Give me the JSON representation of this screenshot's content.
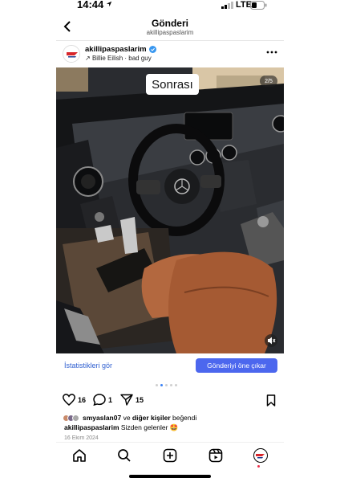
{
  "status_bar": {
    "time": "14:44",
    "network": "LTE"
  },
  "header": {
    "title": "Gönderi",
    "subtitle": "akillipaspaslarim"
  },
  "post": {
    "username": "akillipaspaslarim",
    "music": "Billie Eilish · bad guy",
    "overlay_text": "Sonrası",
    "counter": "2/5",
    "insights_link": "İstatistikleri gör",
    "promote_button": "Gönderiyi öne çıkar",
    "carousel": {
      "count": 5,
      "active": 2
    },
    "likes_count": "16",
    "comments_count": "1",
    "shares_count": "15",
    "liked_by_user": "smyaslan07",
    "liked_by_rest": "diğer kişiler",
    "liked_by_connector": " ve ",
    "liked_by_suffix": " beğendi",
    "caption_user": "akillipaspaslarim",
    "caption_text": " Sizden gelenler 🤩",
    "date": "16 Ekim 2024"
  },
  "colors": {
    "accent": "#4c67ee",
    "link": "#2f5fd0",
    "seat": "#b3683f",
    "verified": "#3897f0"
  },
  "icons": [
    "back-icon",
    "more-icon",
    "verified-icon",
    "heart-icon",
    "comment-icon",
    "share-icon",
    "bookmark-icon",
    "home-icon",
    "search-icon",
    "create-icon",
    "reels-icon",
    "profile-icon",
    "mute-icon"
  ]
}
